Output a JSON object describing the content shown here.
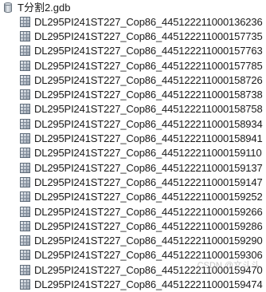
{
  "tree": {
    "root": {
      "label": "T分割2.gdb",
      "icon": "geodatabase-icon"
    },
    "items": [
      "DL295PI241ST227_Cop86_445122211000136236",
      "DL295PI241ST227_Cop86_445122211000157735",
      "DL295PI241ST227_Cop86_445122211000157763",
      "DL295PI241ST227_Cop86_445122211000157785",
      "DL295PI241ST227_Cop86_445122211000158726",
      "DL295PI241ST227_Cop86_445122211000158738",
      "DL295PI241ST227_Cop86_445122211000158758",
      "DL295PI241ST227_Cop86_445122211000158934",
      "DL295PI241ST227_Cop86_445122211000158941",
      "DL295PI241ST227_Cop86_445122211000159110",
      "DL295PI241ST227_Cop86_445122211000159137",
      "DL295PI241ST227_Cop86_445122211000159147",
      "DL295PI241ST227_Cop86_445122211000159252",
      "DL295PI241ST227_Cop86_445122211000159266",
      "DL295PI241ST227_Cop86_445122211000159286",
      "DL295PI241ST227_Cop86_445122211000159290",
      "DL295PI241ST227_Cop86_445122211000159306",
      "DL295PI241ST227_Cop86_445122211000159470",
      "DL295PI241ST227_Cop86_445122211000159474"
    ],
    "item_icon": "raster-dataset-icon"
  },
  "watermark": "CSDN @文斗斗"
}
